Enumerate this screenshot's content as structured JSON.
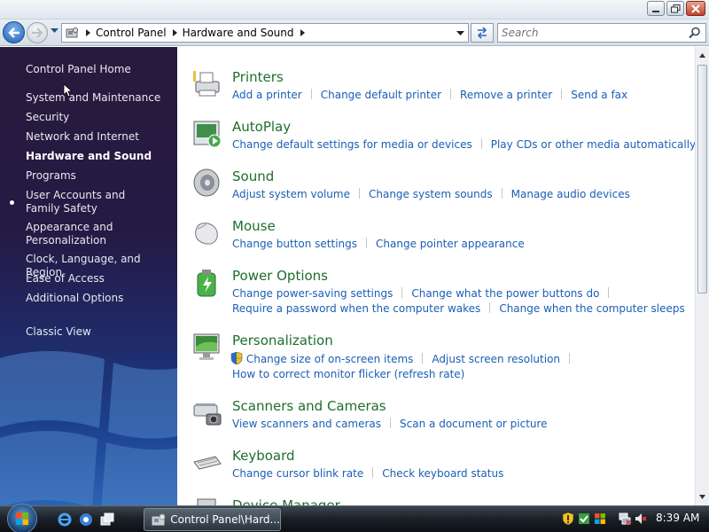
{
  "address": {
    "crumbs": [
      "Control Panel",
      "Hardware and Sound"
    ]
  },
  "search": {
    "placeholder": "Search"
  },
  "sidebar": {
    "items": [
      {
        "label": "Control Panel Home"
      },
      {
        "label": "System and Maintenance"
      },
      {
        "label": "Security"
      },
      {
        "label": "Network and Internet"
      },
      {
        "label": "Hardware and Sound",
        "active": true
      },
      {
        "label": "Programs"
      },
      {
        "label": "User Accounts and Family Safety"
      },
      {
        "label": "Appearance and Personalization"
      },
      {
        "label": "Clock, Language, and Region"
      },
      {
        "label": "Ease of Access"
      },
      {
        "label": "Additional Options"
      },
      {
        "label": "Classic View"
      }
    ]
  },
  "groups": [
    {
      "title": "Printers",
      "icon": "printer-icon",
      "lines": [
        [
          "Add a printer",
          "Change default printer",
          "Remove a printer",
          "Send a fax"
        ]
      ]
    },
    {
      "title": "AutoPlay",
      "icon": "autoplay-icon",
      "lines": [
        [
          "Change default settings for media or devices",
          "Play CDs or other media automatically"
        ]
      ]
    },
    {
      "title": "Sound",
      "icon": "speaker-icon",
      "lines": [
        [
          "Adjust system volume",
          "Change system sounds",
          "Manage audio devices"
        ]
      ]
    },
    {
      "title": "Mouse",
      "icon": "mouse-icon",
      "lines": [
        [
          "Change button settings",
          "Change pointer appearance"
        ]
      ]
    },
    {
      "title": "Power Options",
      "icon": "battery-icon",
      "lines": [
        [
          "Change power-saving settings",
          "Change what the power buttons do"
        ],
        [
          "Require a password when the computer wakes",
          "Change when the computer sleeps"
        ]
      ]
    },
    {
      "title": "Personalization",
      "icon": "monitor-icon",
      "lines": [
        [
          "Change size of on-screen items",
          "Adjust screen resolution"
        ],
        [
          "How to correct monitor flicker (refresh rate)"
        ]
      ]
    },
    {
      "title": "Scanners and Cameras",
      "icon": "scanner-icon",
      "lines": [
        [
          "View scanners and cameras",
          "Scan a document or picture"
        ]
      ]
    },
    {
      "title": "Keyboard",
      "icon": "keyboard-icon",
      "lines": [
        [
          "Change cursor blink rate",
          "Check keyboard status"
        ]
      ]
    },
    {
      "title": "Device Manager",
      "icon": "device-manager-icon",
      "lines": []
    }
  ],
  "taskbar": {
    "window_button": "Control Panel\\Hard...",
    "clock": "8:39 AM"
  },
  "colors": {
    "link": "#1a5fb4",
    "group_title": "#1e6e2d",
    "sidebar_top": "#281a3c",
    "sidebar_bottom": "#2a63b4"
  }
}
